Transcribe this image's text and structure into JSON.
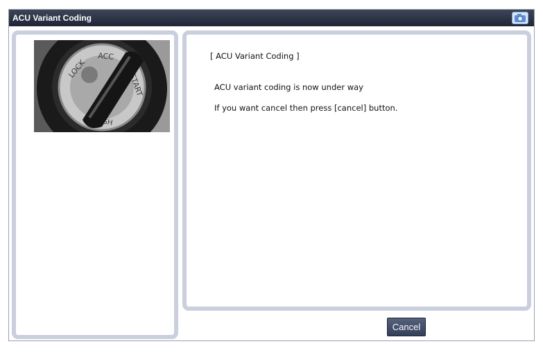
{
  "window": {
    "title": "ACU Variant Coding",
    "title_icon": "camera-icon"
  },
  "image": {
    "icon": "ignition-key-switch-image",
    "positions": [
      "LOCK",
      "ACC",
      "START",
      "PUSH"
    ]
  },
  "message": {
    "heading": "[ ACU Variant Coding ]",
    "line1": "ACU variant coding is now under way",
    "line2": "If you want cancel then press [cancel] button."
  },
  "buttons": {
    "cancel_label": "Cancel"
  },
  "colors": {
    "titlebar": "#2a3144",
    "panel_border": "#c9cfdd",
    "button": "#3e4a63"
  }
}
